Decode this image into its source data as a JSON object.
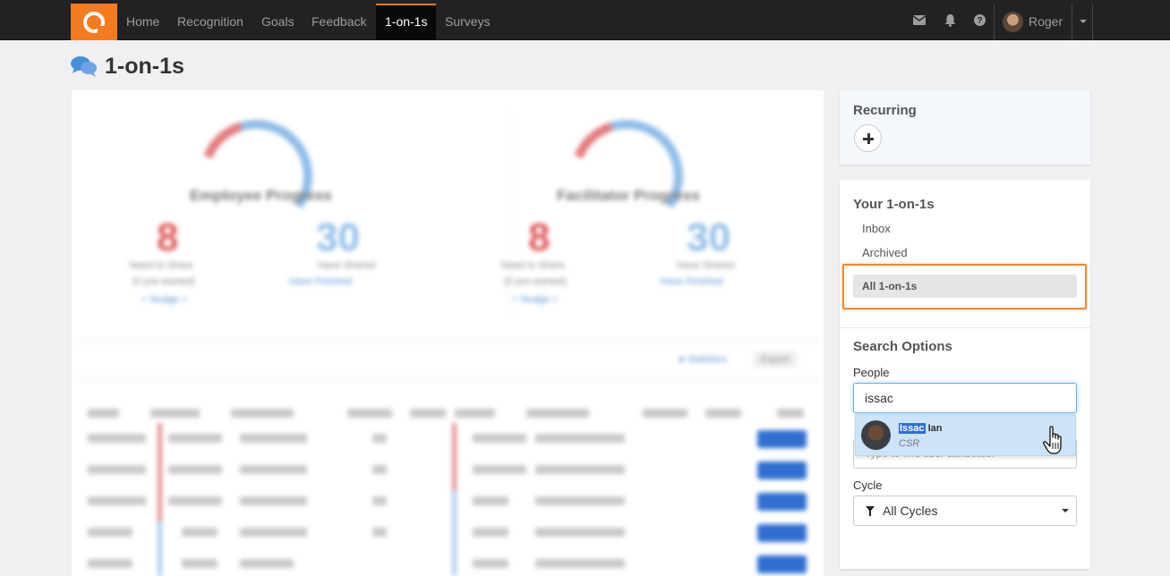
{
  "nav": {
    "items": [
      {
        "label": "Home"
      },
      {
        "label": "Recognition"
      },
      {
        "label": "Goals"
      },
      {
        "label": "Feedback"
      },
      {
        "label": "1-on-1s",
        "active": true
      },
      {
        "label": "Surveys"
      }
    ],
    "icons": [
      "envelope-icon",
      "bell-icon",
      "help-icon"
    ],
    "user_name": "Roger",
    "accent_color": "#f47b20"
  },
  "page": {
    "title": "1-on-1s",
    "title_icon": "chat-bubbles-icon"
  },
  "sidebar": {
    "recurring_title": "Recurring",
    "your_title": "Your 1-on-1s",
    "links": [
      "Inbox",
      "Archived"
    ],
    "active_link": "All 1-on-1s",
    "search_title": "Search Options",
    "people_label": "People",
    "people_value": "issac",
    "attributes_placeholder": "Type to find user attributes.",
    "cycle_label": "Cycle",
    "cycle_value": "All Cycles"
  },
  "suggestion": {
    "name_match": "Issac",
    "name_rest": "Ian",
    "role": "CSR"
  }
}
